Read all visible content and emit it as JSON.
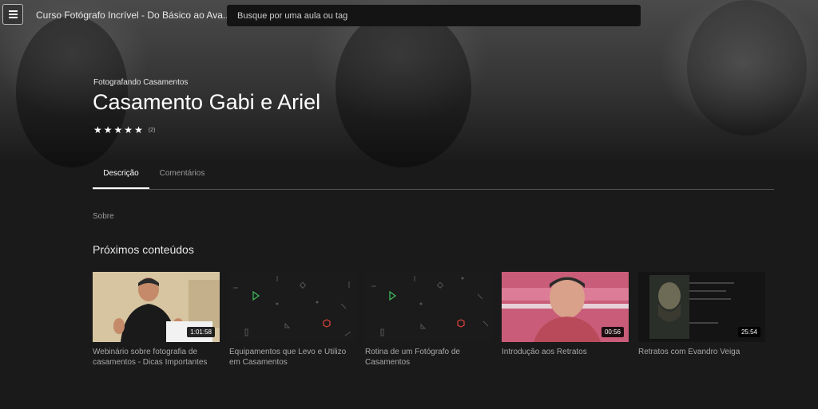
{
  "header": {
    "course_title": "Curso Fotógrafo Incrível - Do Básico ao Ava...",
    "search_placeholder": "Busque por uma aula ou tag"
  },
  "hero": {
    "category": "Fotografando Casamentos",
    "title": "Casamento Gabi e Ariel",
    "rating_stars": 5,
    "rating_count": "(2)"
  },
  "tabs": [
    {
      "label": "Descrição",
      "active": true
    },
    {
      "label": "Comentários",
      "active": false
    }
  ],
  "description": {
    "about_label": "Sobre"
  },
  "next": {
    "heading": "Próximos conteúdos",
    "items": [
      {
        "title": "Webinário sobre fotografia de casamentos - Dicas Importantes",
        "duration": "1:01:58"
      },
      {
        "title": "Equipamentos que Levo e Utilizo em Casamentos",
        "duration": ""
      },
      {
        "title": "Rotina de um Fotógrafo de Casamentos",
        "duration": ""
      },
      {
        "title": "Introdução aos Retratos",
        "duration": "00:56"
      },
      {
        "title": "Retratos com Evandro Veiga",
        "duration": "25:54"
      }
    ]
  },
  "colors": {
    "background": "#1a1a1a",
    "accent_green": "#3fbf5f",
    "accent_red": "#e0443a"
  }
}
